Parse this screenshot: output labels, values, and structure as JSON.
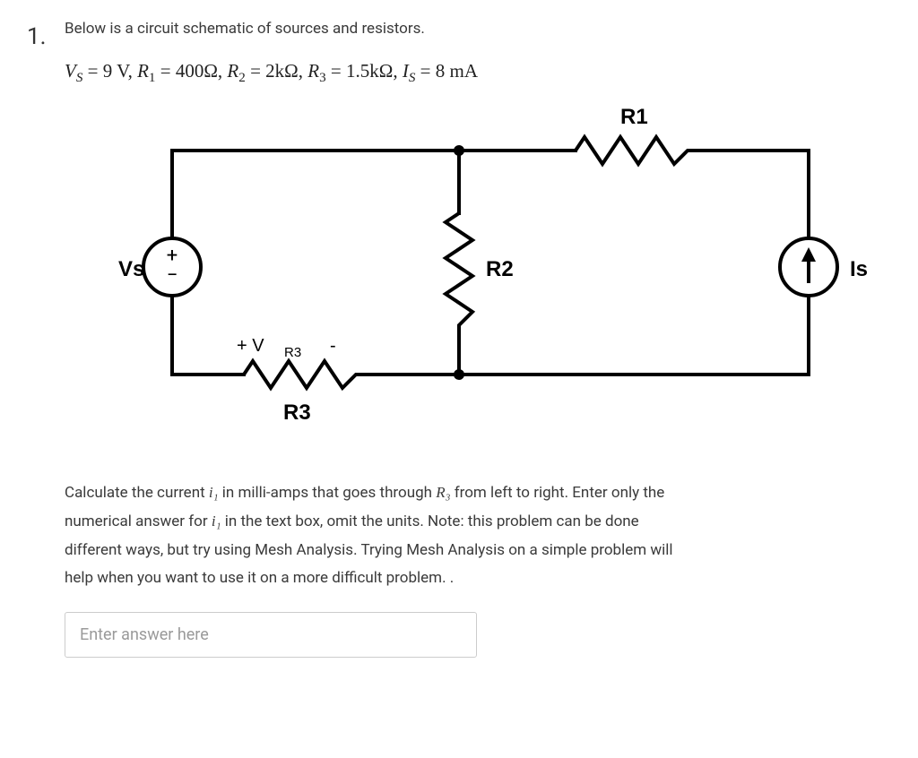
{
  "question_number": "1.",
  "intro": "Below is a circuit schematic of sources and resistors.",
  "params_text": "Vₛ = 9 V, R₁ = 400Ω, R₂ = 2kΩ, R₃ = 1.5kΩ, Iₛ = 8 mA",
  "params": {
    "Vs": "9 V",
    "R1": "400Ω",
    "R2": "2kΩ",
    "R3": "1.5kΩ",
    "Is": "8 mA"
  },
  "circuit": {
    "labels": {
      "Vs": "Vs",
      "Is": "Is",
      "R1": "R1",
      "R2": "R2",
      "R3": "R3",
      "VR3_plus": "+ V",
      "VR3_sub": "R3",
      "VR3_minus": "-",
      "vs_plus": "+",
      "vs_minus": "−"
    }
  },
  "description_line1_pre": "Calculate the current ",
  "description_i1_a": "i₁",
  "description_line1_mid": " in milli-amps that goes through ",
  "description_R3": "R₃",
  "description_line1_post": " from left to right. Enter only the",
  "description_line2_pre": "numerical answer for ",
  "description_i1_b": "i₁",
  "description_line2_post": " in the text box, omit the units. Note: this problem can be done",
  "description_line3": "different ways, but try using Mesh Analysis. Trying Mesh Analysis on a simple problem will",
  "description_line4": "help when you want to use it on a more difficult problem. .",
  "answer_placeholder": "Enter answer here"
}
